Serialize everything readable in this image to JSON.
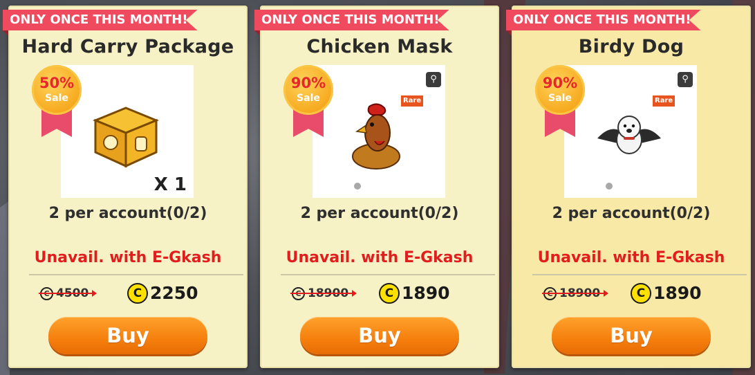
{
  "products": [
    {
      "ribbon": "ONLY ONCE THIS MONTH!",
      "name": "Hard Carry Package",
      "sale_percent": "50%",
      "sale_label": "Sale",
      "quantity": "X 1",
      "limit": "2 per account(0/2)",
      "unavailable_note": "Unavail. with E-Gkash",
      "original_price": "4500",
      "sale_price": "2250",
      "buy_label": "Buy",
      "item_icon": "golden-box-icon"
    },
    {
      "ribbon": "ONLY ONCE THIS MONTH!",
      "name": "Chicken Mask",
      "sale_percent": "90%",
      "sale_label": "Sale",
      "rarity": "Rare",
      "limit": "2 per account(0/2)",
      "unavailable_note": "Unavail. with E-Gkash",
      "original_price": "18900",
      "sale_price": "1890",
      "buy_label": "Buy",
      "item_icon": "chicken-mask-icon"
    },
    {
      "ribbon": "ONLY ONCE THIS MONTH!",
      "name": "Birdy Dog",
      "sale_percent": "90%",
      "sale_label": "Sale",
      "rarity": "Rare",
      "limit": "2 per account(0/2)",
      "unavailable_note": "Unavail. with E-Gkash",
      "original_price": "18900",
      "sale_price": "1890",
      "buy_label": "Buy",
      "item_icon": "birdy-dog-icon"
    }
  ],
  "currency_symbol": "C",
  "colors": {
    "ribbon": "#ef4a5e",
    "unavailable_text": "#e21d1d",
    "buy_button": "#f57f0d",
    "card_background": "#f7f1c6",
    "coin": "#ffe100"
  }
}
